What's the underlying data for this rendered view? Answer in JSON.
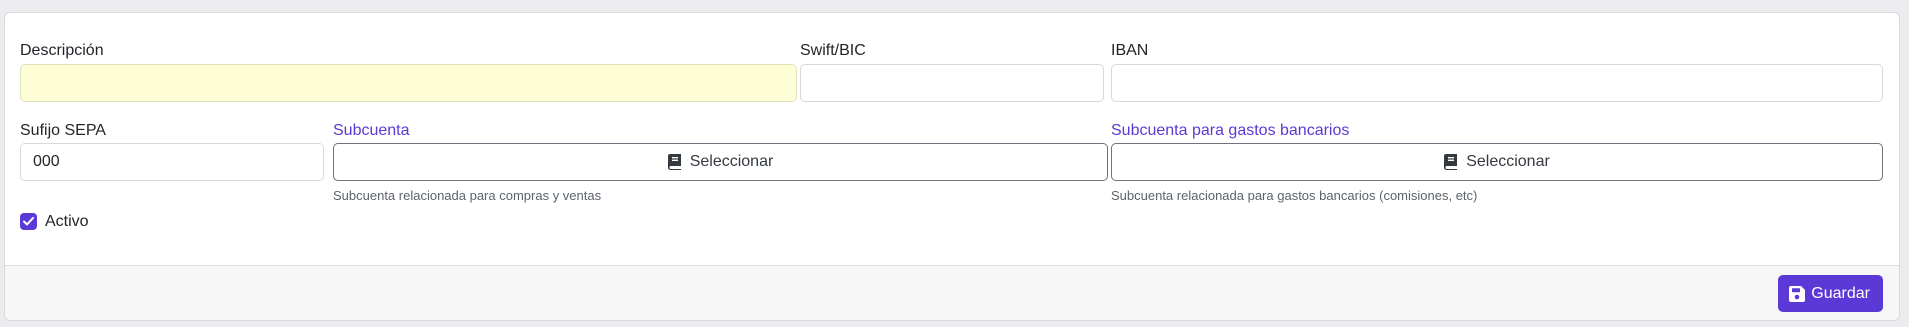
{
  "form": {
    "descripcion": {
      "label": "Descripción",
      "value": ""
    },
    "swift": {
      "label": "Swift/BIC",
      "value": ""
    },
    "iban": {
      "label": "IBAN",
      "value": ""
    },
    "sufijo": {
      "label": "Sufijo SEPA",
      "value": "000"
    },
    "subcuenta": {
      "label": "Subcuenta",
      "button_label": "Seleccionar",
      "help": "Subcuenta relacionada para compras y ventas"
    },
    "subcuenta_gastos": {
      "label": "Subcuenta para gastos bancarios",
      "button_label": "Seleccionar",
      "help": "Subcuenta relacionada para gastos bancarios (comisiones, etc)"
    },
    "activo": {
      "label": "Activo",
      "checked": true
    }
  },
  "footer": {
    "save_label": "Guardar"
  },
  "icons": {
    "select": "book-icon",
    "save": "floppy-disk-icon",
    "check": "check-icon"
  },
  "colors": {
    "accent": "#5b39d6",
    "required_bg": "#fefed6"
  }
}
